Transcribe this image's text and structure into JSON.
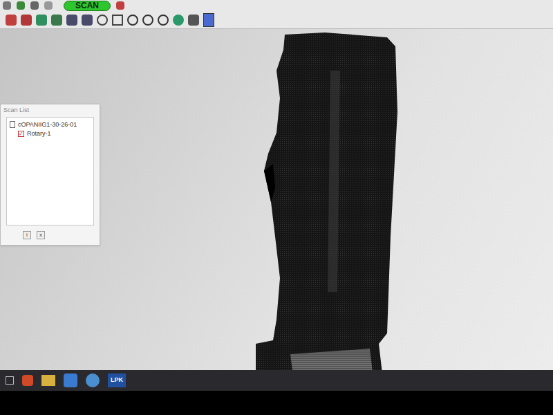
{
  "toolbar": {
    "scan_button": "SCAN"
  },
  "scan_list": {
    "title": "Scan List",
    "items": [
      {
        "label": "cOPANIIG1-30-26-01",
        "checked": false,
        "indent": 0
      },
      {
        "label": "Rotary-1",
        "checked": true,
        "indent": 1
      }
    ],
    "footer_buttons": [
      "i",
      "x"
    ]
  },
  "taskbar": {
    "apps": [
      {
        "label": "LPK"
      }
    ]
  }
}
